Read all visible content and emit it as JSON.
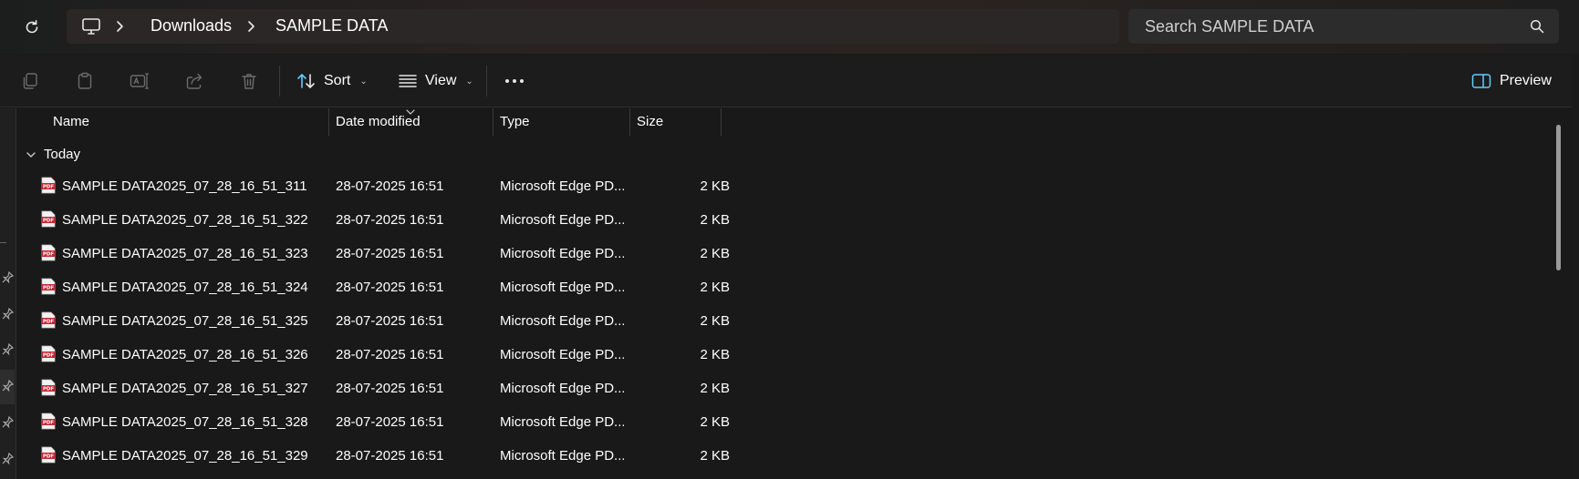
{
  "breadcrumb": {
    "items": [
      "Downloads",
      "SAMPLE DATA"
    ]
  },
  "search": {
    "placeholder": "Search SAMPLE DATA"
  },
  "toolbar": {
    "sort_label": "Sort",
    "view_label": "View",
    "preview_label": "Preview",
    "icons": [
      "copy-icon",
      "paste-icon",
      "rename-icon",
      "share-icon",
      "delete-icon",
      "more-icon"
    ]
  },
  "columns": {
    "name": "Name",
    "date_modified": "Date modified",
    "type": "Type",
    "size": "Size"
  },
  "group": {
    "label": "Today"
  },
  "files": [
    {
      "name": "SAMPLE DATA2025_07_28_16_51_311",
      "date": "28-07-2025 16:51",
      "type": "Microsoft Edge PD...",
      "size": "2 KB"
    },
    {
      "name": "SAMPLE DATA2025_07_28_16_51_322",
      "date": "28-07-2025 16:51",
      "type": "Microsoft Edge PD...",
      "size": "2 KB"
    },
    {
      "name": "SAMPLE DATA2025_07_28_16_51_323",
      "date": "28-07-2025 16:51",
      "type": "Microsoft Edge PD...",
      "size": "2 KB"
    },
    {
      "name": "SAMPLE DATA2025_07_28_16_51_324",
      "date": "28-07-2025 16:51",
      "type": "Microsoft Edge PD...",
      "size": "2 KB"
    },
    {
      "name": "SAMPLE DATA2025_07_28_16_51_325",
      "date": "28-07-2025 16:51",
      "type": "Microsoft Edge PD...",
      "size": "2 KB"
    },
    {
      "name": "SAMPLE DATA2025_07_28_16_51_326",
      "date": "28-07-2025 16:51",
      "type": "Microsoft Edge PD...",
      "size": "2 KB"
    },
    {
      "name": "SAMPLE DATA2025_07_28_16_51_327",
      "date": "28-07-2025 16:51",
      "type": "Microsoft Edge PD...",
      "size": "2 KB"
    },
    {
      "name": "SAMPLE DATA2025_07_28_16_51_328",
      "date": "28-07-2025 16:51",
      "type": "Microsoft Edge PD...",
      "size": "2 KB"
    },
    {
      "name": "SAMPLE DATA2025_07_28_16_51_329",
      "date": "28-07-2025 16:51",
      "type": "Microsoft Edge PD...",
      "size": "2 KB"
    }
  ],
  "colors": {
    "background": "#191919",
    "pdf_icon": "#c4262e",
    "accent": "#60cdff"
  }
}
